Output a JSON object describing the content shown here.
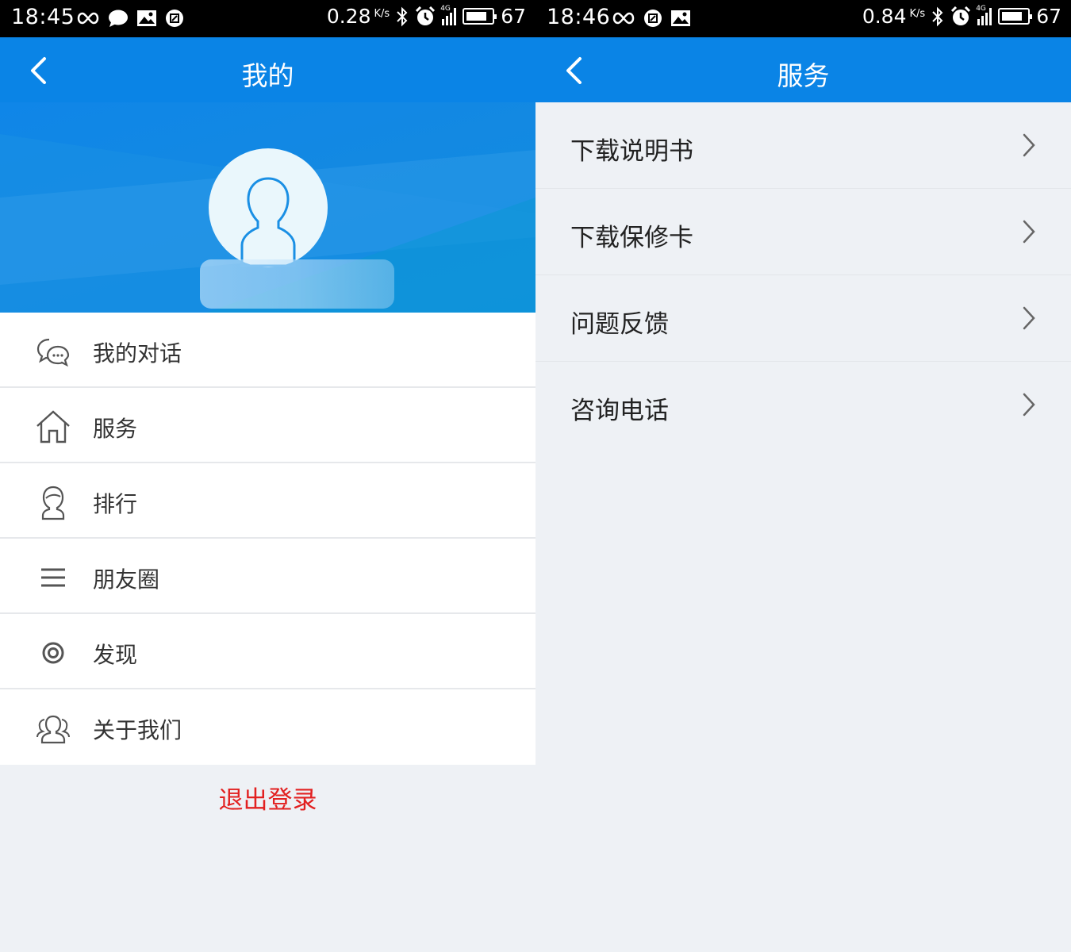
{
  "left": {
    "status": {
      "time": "18:45",
      "speed": "0.28",
      "unit": "K/s",
      "network": "4G",
      "battery": "67"
    },
    "header": {
      "title": "我的"
    },
    "menu": [
      {
        "label": "我的对话",
        "icon": "chat-bubbles-icon"
      },
      {
        "label": "服务",
        "icon": "home-icon"
      },
      {
        "label": "排行",
        "icon": "person-icon"
      },
      {
        "label": "朋友圈",
        "icon": "menu-lines-icon"
      },
      {
        "label": "发现",
        "icon": "target-icon"
      },
      {
        "label": "关于我们",
        "icon": "people-icon"
      }
    ],
    "logout": "退出登录"
  },
  "right": {
    "status": {
      "time": "18:46",
      "speed": "0.84",
      "unit": "K/s",
      "network": "4G",
      "battery": "67"
    },
    "header": {
      "title": "服务"
    },
    "items": [
      {
        "label": "下载说明书"
      },
      {
        "label": "下载保修卡"
      },
      {
        "label": "问题反馈"
      },
      {
        "label": "咨询电话"
      }
    ]
  },
  "colors": {
    "accent": "#0a84e6",
    "logout": "#e22020",
    "background": "#eef1f5"
  }
}
